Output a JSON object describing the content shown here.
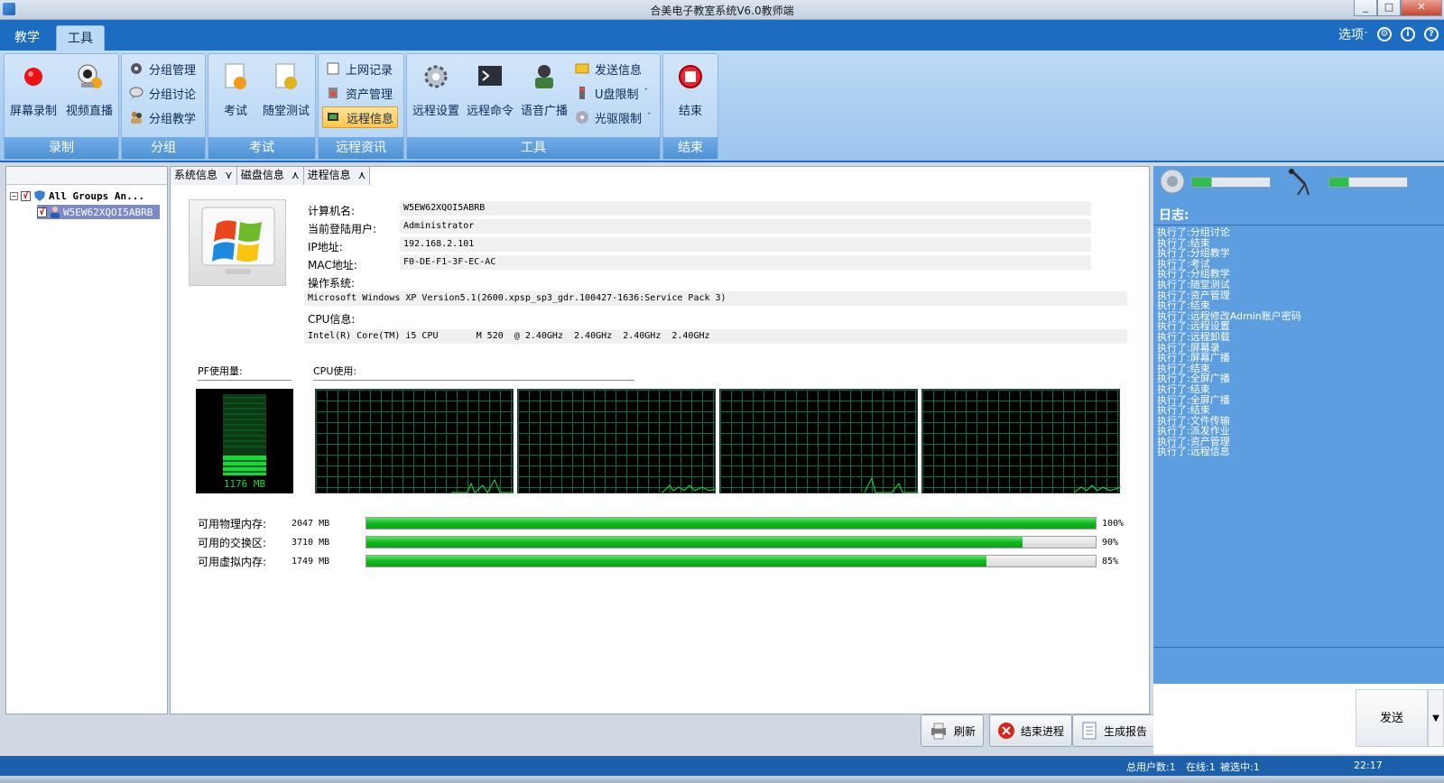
{
  "window": {
    "title": "合美电子教室系统V6.0教师端"
  },
  "menu": {
    "tabs": [
      "教学",
      "工具"
    ],
    "active_tab": "工具",
    "options_label": "选项",
    "options_arrow": "ˇ"
  },
  "ribbon": {
    "groups": {
      "record": {
        "label": "录制",
        "screen_record": "屏幕录制",
        "video_live": "视频直播"
      },
      "group": {
        "label": "分组",
        "manage": "分组管理",
        "discuss": "分组讨论",
        "teach": "分组教学"
      },
      "exam": {
        "label": "考试",
        "exam": "考试",
        "quiz": "随堂测试"
      },
      "remote_info": {
        "label": "远程资讯",
        "web_log": "上网记录",
        "asset": "资产管理",
        "remote_info": "远程信息"
      },
      "tools": {
        "label": "工具",
        "remote_settings": "远程设置",
        "remote_command": "远程命令",
        "voice_broadcast": "语音广播",
        "send_message": "发送信息",
        "usb_limit": "U盘限制",
        "cd_limit": "光驱限制",
        "drop_arrow": "ˇ"
      },
      "end": {
        "label": "结束",
        "end": "结束"
      }
    }
  },
  "tree": {
    "root": "All Groups An...",
    "child": "W5EW62XQOI5ABRB",
    "expander": "−",
    "checkmark": "√"
  },
  "tabs": [
    "系统信息",
    "磁盘信息",
    "进程信息"
  ],
  "tab_icons": {
    "system": "⋎",
    "disk": "⋏",
    "process": "⋏"
  },
  "sysinfo": {
    "computer_name_label": "计算机名:",
    "computer_name": "W5EW62XQOI5ABRB",
    "user_label": "当前登陆用户:",
    "user": "Administrator",
    "ip_label": "IP地址:",
    "ip": "192.168.2.101",
    "mac_label": "MAC地址:",
    "mac": "F0-DE-F1-3F-EC-AC",
    "os_label": "操作系统:",
    "os": "Microsoft Windows XP Version5.1(2600.xpsp_sp3_gdr.100427-1636:Service Pack 3)",
    "cpu_label": "CPU信息:",
    "cpu": "Intel(R) Core(TM) i5 CPU       M 520  @ 2.40GHz  2.40GHz  2.40GHz  2.40GHz"
  },
  "monitor": {
    "pf_label": "PF使用量:",
    "pf_value": "1176 MB",
    "cpu_label": "CPU使用:"
  },
  "memory": [
    {
      "label": "可用物理内存:",
      "value": "2047 MB",
      "pct": "100%",
      "fill": 1.0
    },
    {
      "label": "可用的交换区:",
      "value": "3710 MB",
      "pct": "90%",
      "fill": 0.9
    },
    {
      "label": "可用虚拟内存:",
      "value": "1749 MB",
      "pct": "85%",
      "fill": 0.85
    }
  ],
  "actions": {
    "refresh": "刷新",
    "kill_process": "结束进程",
    "report": "生成报告"
  },
  "log": {
    "header": "日志:",
    "entries": [
      "执行了:分组讨论",
      "执行了:结束",
      "执行了:分组教学",
      "执行了:考试",
      "执行了:分组教学",
      "执行了:随堂测试",
      "执行了:资产管理",
      "执行了:结束",
      "执行了:远程修改Admin账户密码",
      "执行了:远程设置",
      "执行了:远程卸载",
      "执行了:屏幕录",
      "执行了:屏幕广播",
      "执行了:结束",
      "执行了:全屏广播",
      "执行了:结束",
      "执行了:全屏广播",
      "执行了:结束",
      "执行了:文件传输",
      "执行了:派发作业",
      "执行了:资产管理",
      "执行了:远程信息"
    ],
    "send_label": "发送"
  },
  "status": {
    "total_users": "总用户数:1",
    "online": "在线:1",
    "selected": "被选中:1",
    "time": "22:17"
  },
  "colors": {
    "accent": "#1c6dc2",
    "progress_green": "#10b91d",
    "log_bg": "#5d9ee0"
  },
  "icons": [
    "record-icon",
    "webcam-icon",
    "group-manage-icon",
    "group-discuss-icon",
    "group-teach-icon",
    "exam-icon",
    "quiz-icon",
    "web-log-icon",
    "asset-icon",
    "remote-info-icon",
    "settings-gear-icon",
    "command-icon",
    "broadcast-icon",
    "message-icon",
    "usb-icon",
    "cd-icon",
    "stop-icon",
    "windows-logo-icon",
    "speaker-icon",
    "microphone-icon"
  ]
}
